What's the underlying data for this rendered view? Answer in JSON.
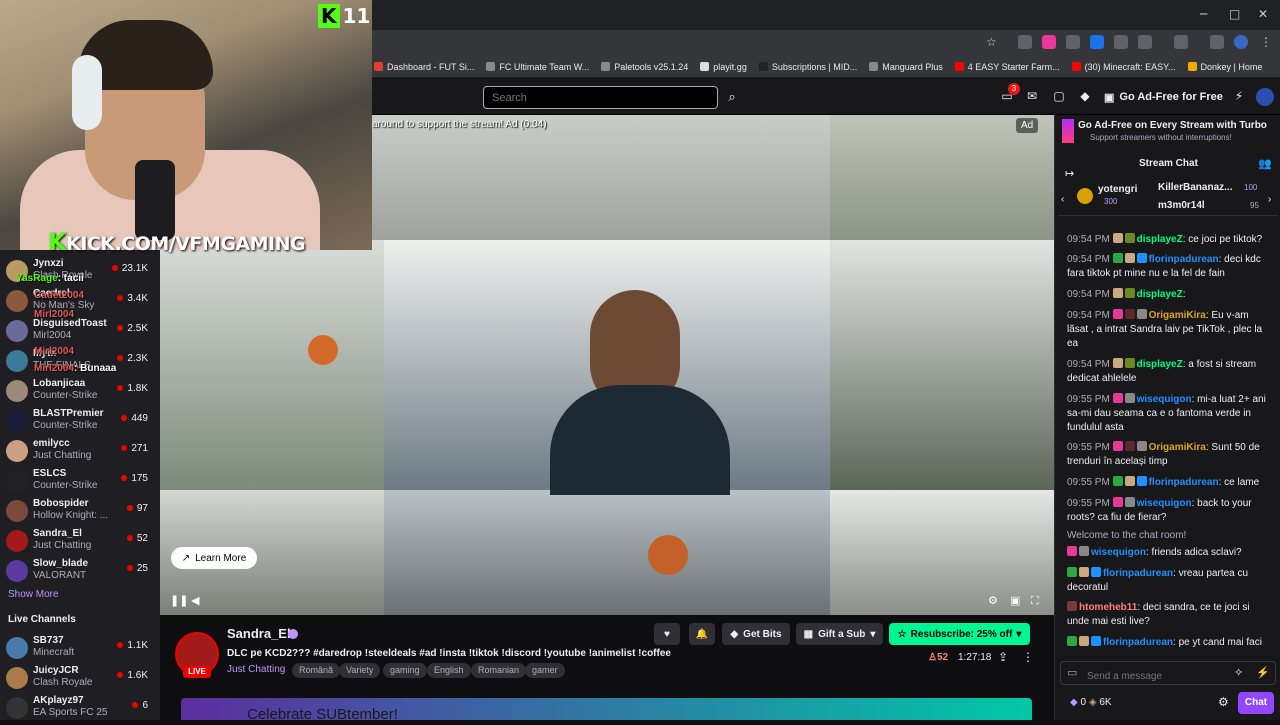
{
  "browser": {
    "bookmarks": [
      "Dashboard - FUT Si...",
      "FC Ultimate Team W...",
      "Paletools v25.1.24",
      "playit.gg",
      "Subscriptions | MID...",
      "Manguard Plus",
      "4 EASY Starter Farm...",
      "(30) Minecraft: EASY...",
      "Donkey | Home"
    ],
    "window_controls": {
      "minimize": "─",
      "maximize": "□",
      "close": "✕"
    }
  },
  "overlay": {
    "kick_count": "11",
    "kick_url": "KICK.COM/VFMGAMING",
    "kick_k": "K",
    "chat": [
      {
        "name": "YasRage",
        "text": ": tacii"
      },
      {
        "name": "Cadet2004",
        "text": ""
      },
      {
        "name": "Mirl2004",
        "text": ""
      },
      {
        "name": "Mirl2004",
        "text": ""
      },
      {
        "name": "Mirl2004",
        "text": ": Bunaaa"
      }
    ]
  },
  "topnav": {
    "search_placeholder": "Search",
    "notif_count": "3",
    "ad_free_label": "Go Ad-Free for Free"
  },
  "sidebar": {
    "channels": [
      {
        "name": "Jynxzi",
        "game": "Clash Royale",
        "viewers": "23.1K"
      },
      {
        "name": "Caedrel",
        "game": "No Man's Sky",
        "viewers": "3.4K"
      },
      {
        "name": "DisguisedToast",
        "game": "Mirl2004",
        "viewers": "2.5K"
      },
      {
        "name": "Myth",
        "game": "THE FINALS",
        "viewers": "2.3K"
      },
      {
        "name": "Lobanjicaa",
        "game": "Counter-Strike",
        "viewers": "1.8K"
      },
      {
        "name": "BLASTPremier",
        "game": "Counter-Strike",
        "viewers": "449"
      },
      {
        "name": "emilycc",
        "game": "Just Chatting",
        "viewers": "271"
      },
      {
        "name": "ESLCS",
        "game": "Counter-Strike",
        "viewers": "175"
      },
      {
        "name": "Bobospider",
        "game": "Hollow Knight: ...",
        "viewers": "97"
      },
      {
        "name": "Sandra_El",
        "game": "Just Chatting",
        "viewers": "52"
      },
      {
        "name": "Slow_blade",
        "game": "VALORANT",
        "viewers": "25"
      }
    ],
    "show_more": "Show More",
    "live_channels_title": "Live Channels",
    "live_channels": [
      {
        "name": "SB737",
        "game": "Minecraft",
        "viewers": "1.1K"
      },
      {
        "name": "JuicyJCR",
        "game": "Clash Royale",
        "viewers": "1.6K"
      },
      {
        "name": "AKplayz97",
        "game": "EA Sports FC 25",
        "viewers": "6"
      }
    ]
  },
  "video": {
    "ad_text": "around to support the stream! Ad (0:04)",
    "ad_badge": "Ad",
    "learn_more": "Learn More"
  },
  "stream": {
    "streamer": "Sandra_El",
    "live": "LIVE",
    "title": "DLC pe KCD2??? #daredrop !steeldeals #ad !insta !tiktok !discord !youtube !animelist !coffee",
    "category": "Just Chatting",
    "tags": [
      "Română",
      "Variety",
      "gaming",
      "English",
      "Romanian",
      "gamer"
    ],
    "get_bits": "Get Bits",
    "gift_sub": "Gift a Sub",
    "resubscribe": "Resubscribe: 25% off",
    "viewers": "52",
    "uptime": "1:27:18",
    "sub_banner": "Celebrate SUBtember!"
  },
  "chat": {
    "turbo_title": "Go Ad-Free on Every Stream with Turbo",
    "turbo_sub": "Support streamers without interruptions!",
    "header": "Stream Chat",
    "leaderboard": [
      {
        "name": "yotengri",
        "points": "300"
      },
      {
        "name": "KillerBananaz...",
        "points": "100"
      },
      {
        "name": "m3m0r14l",
        "points": "95"
      }
    ],
    "messages": [
      {
        "time": "09:54 PM",
        "user": "displayeZ",
        "color": "#00ff7f",
        "text": ": ce joci pe tiktok?"
      },
      {
        "time": "09:54 PM",
        "user": "florinpadurean",
        "color": "#1e90ff",
        "text": ": deci kdc fara tiktok pt mine nu e la fel de fain"
      },
      {
        "time": "09:54 PM",
        "user": "displayeZ",
        "color": "#00ff7f",
        "text": ":"
      },
      {
        "time": "09:54 PM",
        "user": "OrigamiKira",
        "color": "#daa520",
        "text": ": Eu v-am lăsat , a intrat Sandra laiv pe TikTok , plec la ea"
      },
      {
        "time": "09:54 PM",
        "user": "displayeZ",
        "color": "#00ff7f",
        "text": ": a fost si stream dedicat ahlelele"
      },
      {
        "time": "09:55 PM",
        "user": "wisequigon",
        "color": "#1e90ff",
        "text": ": mi-a luat 2+ ani sa-mi dau seama ca e o fantoma verde in fundulul asta"
      },
      {
        "time": "09:55 PM",
        "user": "OrigamiKira",
        "color": "#daa520",
        "text": ": Sunt 50 de trenduri în același timp"
      },
      {
        "time": "09:55 PM",
        "user": "florinpadurean",
        "color": "#1e90ff",
        "text": ": ce lame"
      },
      {
        "time": "09:55 PM",
        "user": "wisequigon",
        "color": "#1e90ff",
        "text": ": back to your roots? ca fiu de fierar?"
      }
    ],
    "welcome": "Welcome to the chat room!",
    "messages2": [
      {
        "user": "wisequigon",
        "color": "#1e90ff",
        "text": ": friends adica sclavi?"
      },
      {
        "user": "florinpadurean",
        "color": "#1e90ff",
        "text": ": vreau partea cu decoratul"
      },
      {
        "user": "htomeheb11",
        "color": "#ff7f7f",
        "text": ": deci sandra, ce te joci si unde mai esti live?"
      },
      {
        "user": "florinpadurean",
        "color": "#1e90ff",
        "text": ": pe yt cand mai faci"
      }
    ],
    "send_placeholder": "Send a message",
    "points_left": "0",
    "points": "6K",
    "chat_button": "Chat"
  }
}
